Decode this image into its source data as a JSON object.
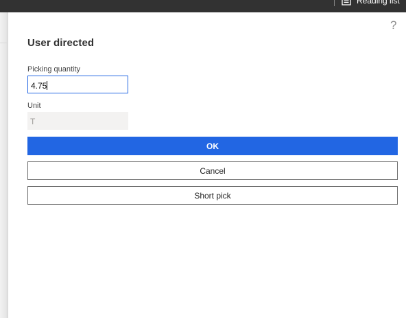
{
  "topbar": {
    "reading_list_label": "Reading list",
    "reading_list_icon": "reading-list-icon"
  },
  "dialog": {
    "help_label": "?",
    "title": "User directed",
    "picking_quantity": {
      "label": "Picking quantity",
      "value": "4.75"
    },
    "unit": {
      "label": "Unit",
      "value": "T"
    },
    "buttons": {
      "ok": "OK",
      "cancel": "Cancel",
      "short_pick": "Short pick"
    }
  },
  "colors": {
    "accent": "#2266e3",
    "topbar": "#323232",
    "disabled_field": "#f3f2f1"
  }
}
